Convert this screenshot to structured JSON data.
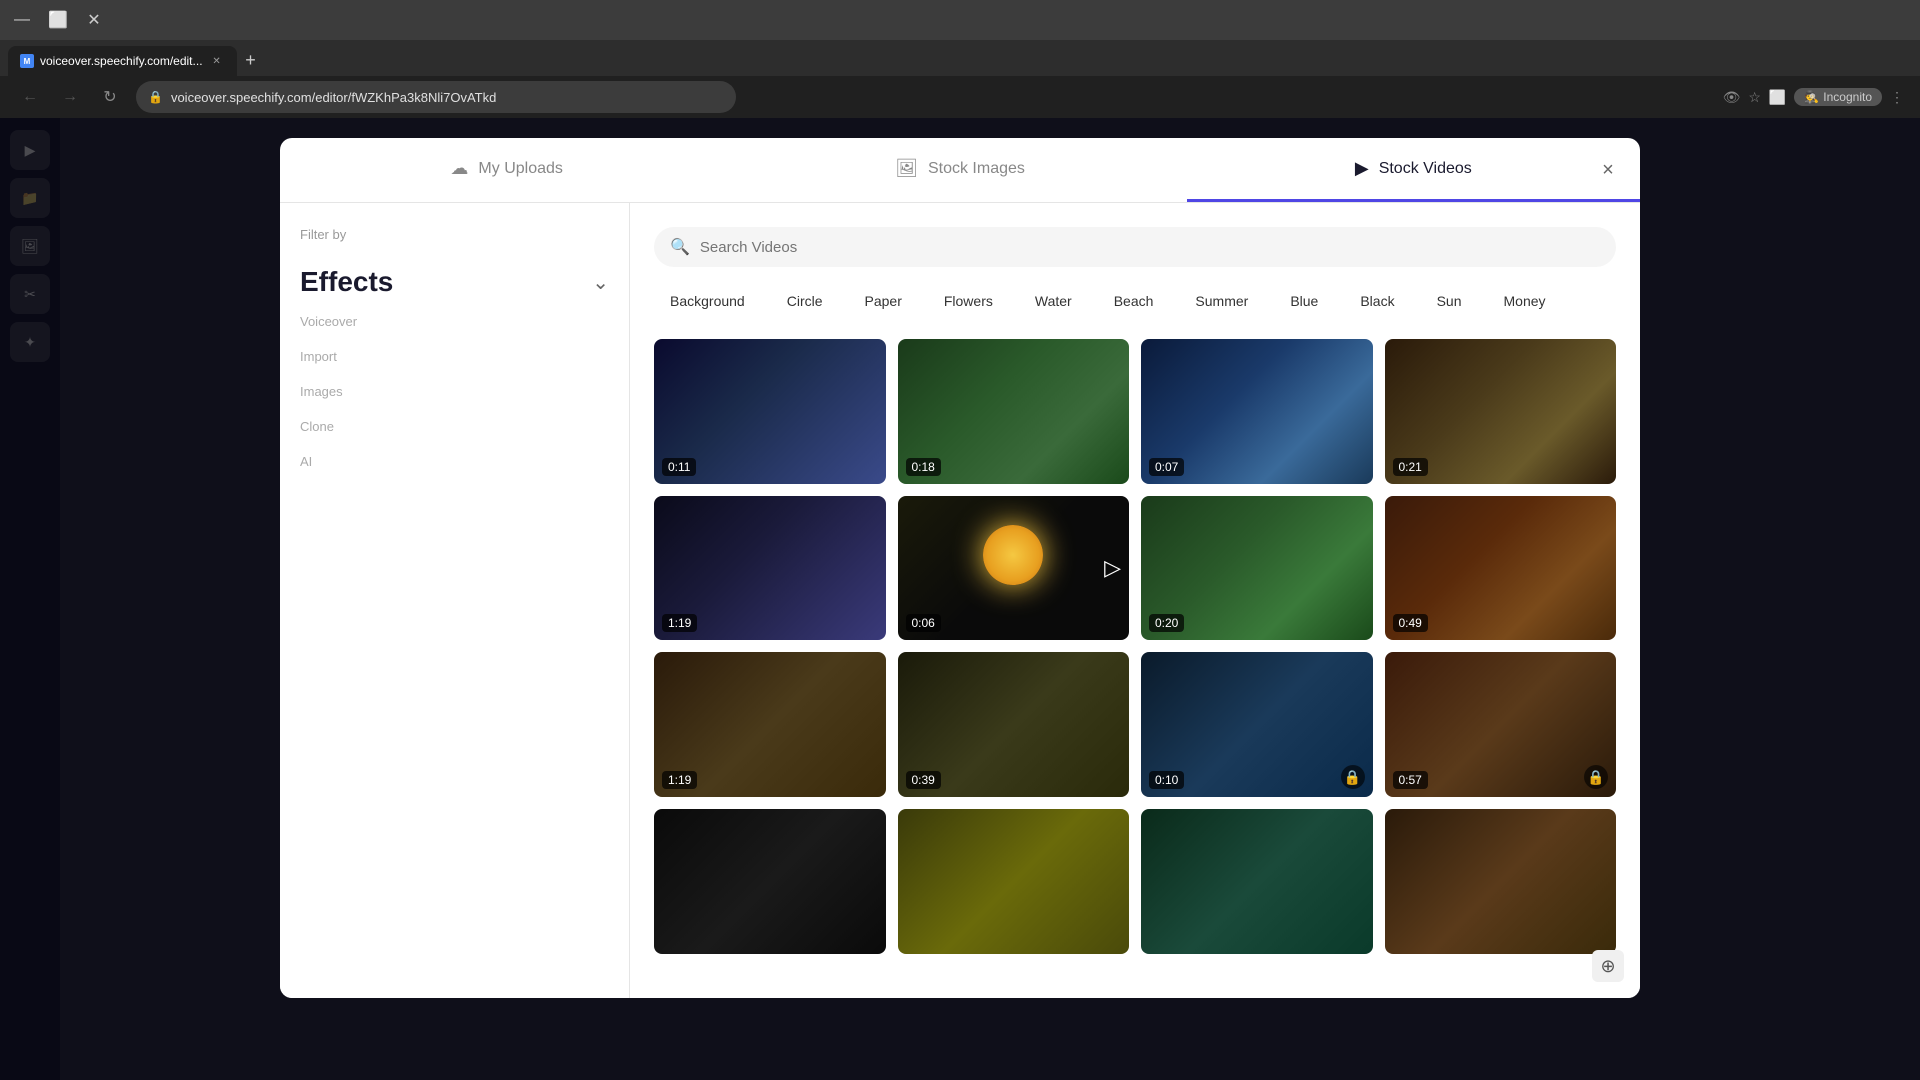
{
  "browser": {
    "url": "voiceover.speechify.com/editor/fWZKhPa3k8Nli7OvATkd",
    "tab_title": "voiceover.speechify.com/edit...",
    "tab_favicon": "M"
  },
  "modal": {
    "close_label": "×",
    "tabs": [
      {
        "id": "my-uploads",
        "label": "My Uploads",
        "icon": "☁"
      },
      {
        "id": "stock-images",
        "label": "Stock Images",
        "icon": "🖼"
      },
      {
        "id": "stock-videos",
        "label": "Stock Videos",
        "icon": "▶",
        "active": true
      }
    ]
  },
  "sidebar": {
    "filter_label": "Filter by",
    "effects_label": "Effects",
    "items": [
      "Voiceover",
      "Import",
      "Images",
      "Clone",
      "AI"
    ]
  },
  "search": {
    "placeholder": "Search Videos"
  },
  "filter_tags": [
    {
      "id": "background",
      "label": "Background"
    },
    {
      "id": "circle",
      "label": "Circle"
    },
    {
      "id": "paper",
      "label": "Paper"
    },
    {
      "id": "flowers",
      "label": "Flowers"
    },
    {
      "id": "water",
      "label": "Water"
    },
    {
      "id": "beach",
      "label": "Beach"
    },
    {
      "id": "summer",
      "label": "Summer"
    },
    {
      "id": "blue",
      "label": "Blue"
    },
    {
      "id": "black",
      "label": "Black"
    },
    {
      "id": "sun",
      "label": "Sun"
    },
    {
      "id": "money",
      "label": "Money"
    }
  ],
  "videos": [
    {
      "id": 1,
      "duration": "0:11",
      "thumb_class": "thumb-1",
      "locked": false
    },
    {
      "id": 2,
      "duration": "0:18",
      "thumb_class": "thumb-2",
      "locked": false
    },
    {
      "id": 3,
      "duration": "0:07",
      "thumb_class": "thumb-3",
      "locked": false
    },
    {
      "id": 4,
      "duration": "0:21",
      "thumb_class": "thumb-4",
      "locked": false
    },
    {
      "id": 5,
      "duration": "1:19",
      "thumb_class": "thumb-5",
      "locked": false
    },
    {
      "id": 6,
      "duration": "0:06",
      "thumb_class": "thumb-6",
      "locked": false,
      "has_play": true
    },
    {
      "id": 7,
      "duration": "0:20",
      "thumb_class": "thumb-7",
      "locked": false
    },
    {
      "id": 8,
      "duration": "0:49",
      "thumb_class": "thumb-8",
      "locked": false
    },
    {
      "id": 9,
      "duration": "1:19",
      "thumb_class": "thumb-9",
      "locked": false
    },
    {
      "id": 10,
      "duration": "0:39",
      "thumb_class": "thumb-10",
      "locked": false
    },
    {
      "id": 11,
      "duration": "0:10",
      "thumb_class": "thumb-11",
      "locked": true
    },
    {
      "id": 12,
      "duration": "0:57",
      "thumb_class": "thumb-12",
      "locked": true
    },
    {
      "id": 13,
      "duration": "",
      "thumb_class": "thumb-13",
      "locked": false
    },
    {
      "id": 14,
      "duration": "",
      "thumb_class": "thumb-14",
      "locked": false
    },
    {
      "id": 15,
      "duration": "",
      "thumb_class": "thumb-15",
      "locked": false
    },
    {
      "id": 16,
      "duration": "",
      "thumb_class": "thumb-16",
      "locked": false
    }
  ],
  "accent_color": "#4f46e5"
}
